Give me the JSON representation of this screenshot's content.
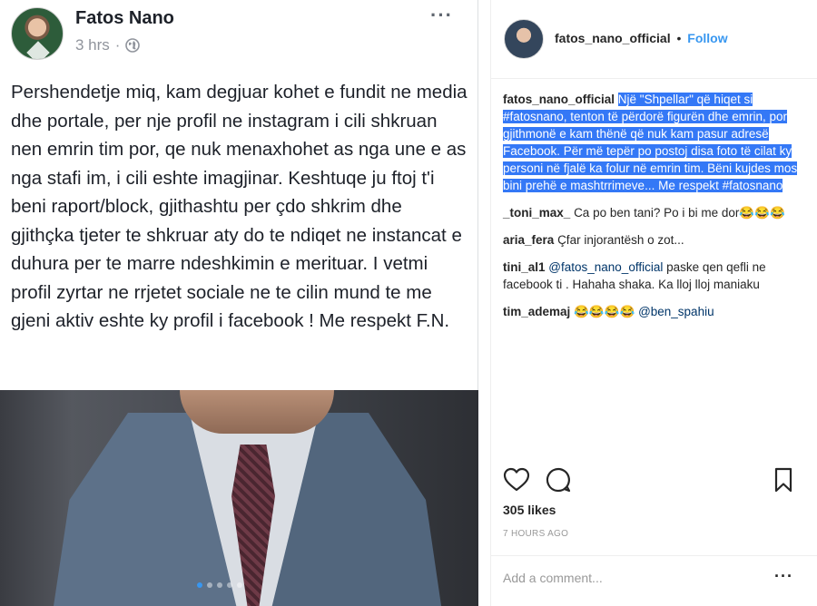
{
  "facebook": {
    "author": "Fatos Nano",
    "time": "3 hrs",
    "dot": "·",
    "more": "···",
    "text": "Pershendetje miq, kam degjuar kohet e fundit ne media dhe portale, per nje profil ne instagram i cili shkruan nen emrin tim por, qe nuk menaxhohet as nga une e as nga stafi im, i cili eshte imagjinar. Keshtuqe ju ftoj t'i beni raport/block, gjithashtu per çdo shkrim dhe gjithçka tjeter te shkruar aty do te ndiqet ne instancat e duhura per te marre ndeshkimin e merituar. I vetmi profil zyrtar ne rrjetet sociale ne te cilin mund te me gjeni aktiv eshte ky profil i facebook ! Me respekt F.N.",
    "photo_dots": 5,
    "active_dot": 0
  },
  "instagram": {
    "handle": "fatos_nano_official",
    "separator": "•",
    "follow": "Follow",
    "caption_user": "fatos_nano_official",
    "caption": "Një \"Shpellar\" që hiqet si #fatosnano, tenton të përdorë figurën dhe emrin, por gjithmonë e kam thënë që nuk kam pasur adresë Facebook. Për më tepër po postoj disa foto të cilat ky personi në fjalë ka folur në emrin tim. Bëni kujdes mos bini prehë e mashtrrimeve... Me respekt #fatosnano",
    "comments": [
      {
        "user": "_toni_max_",
        "text": "Ca po ben tani? Po i bi me dor😂😂😂"
      },
      {
        "user": "aria_fera",
        "text": "Çfar injorantësh o zot..."
      },
      {
        "user": "tini_al1",
        "mention": "@fatos_nano_official",
        "text": " paske qen qefli ne facebook ti . Hahaha shaka. Ka lloj lloj maniaku"
      },
      {
        "user": "tim_ademaj",
        "text": "😂😂😂😂 ",
        "mention": "@ben_spahiu"
      }
    ],
    "likes": "305 likes",
    "time": "7 HOURS AGO",
    "add_comment_placeholder": "Add a comment...",
    "more": "···",
    "colors": {
      "link": "#3897f0",
      "highlight": "#3478f6"
    }
  }
}
